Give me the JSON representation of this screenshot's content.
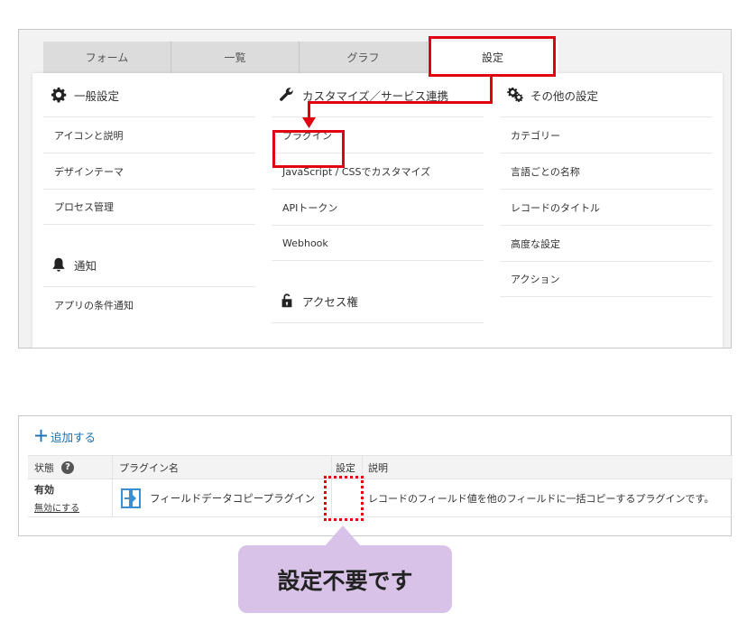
{
  "tabs": [
    {
      "label": "フォーム"
    },
    {
      "label": "一覧"
    },
    {
      "label": "グラフ"
    },
    {
      "label": "設定",
      "active": true
    }
  ],
  "columns": {
    "general": {
      "heading": "一般設定",
      "icon": "gear-icon",
      "items": [
        "アイコンと説明",
        "デザインテーマ",
        "プロセス管理"
      ]
    },
    "notification": {
      "heading": "通知",
      "icon": "bell-icon",
      "items": [
        "アプリの条件通知"
      ]
    },
    "customize": {
      "heading": "カスタマイズ／サービス連携",
      "icon": "wrench-icon",
      "items": [
        "プラグイン",
        "JavaScript / CSSでカスタマイズ",
        "APIトークン",
        "Webhook"
      ]
    },
    "access": {
      "heading": "アクセス権",
      "icon": "lock-icon"
    },
    "other": {
      "heading": "その他の設定",
      "icon": "gears-icon",
      "items": [
        "カテゴリー",
        "言語ごとの名称",
        "レコードのタイトル",
        "高度な設定",
        "アクション"
      ]
    }
  },
  "highlight_color": "#e00010",
  "plugins": {
    "add_label": "追加する",
    "headers": {
      "status": "状態",
      "name": "プラグイン名",
      "settings": "設定",
      "description": "説明"
    },
    "rows": [
      {
        "status": "有効",
        "toggle_link": "無効にする",
        "name": "フィールドデータコピープラグイン",
        "description": "レコードのフィールド値を他のフィールドに一括コピーするプラグインです。"
      }
    ]
  },
  "callout": {
    "text": "設定不要です",
    "color": "#d8c2e8"
  }
}
